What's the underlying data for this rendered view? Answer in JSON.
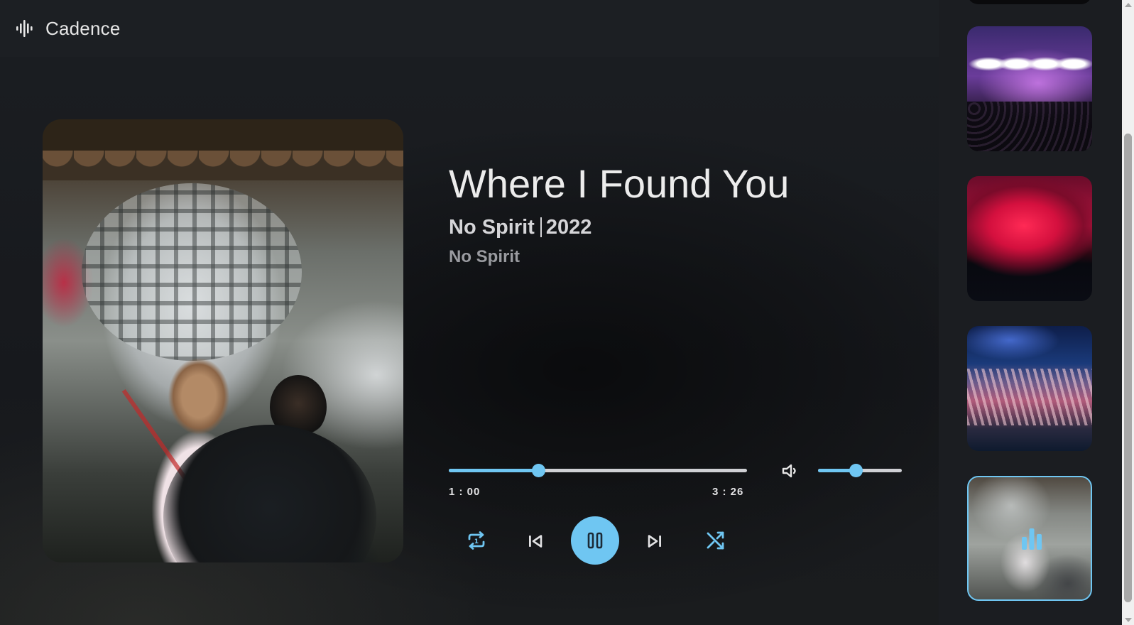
{
  "app": {
    "title": "Cadence",
    "logo_icon": "waveform-icon"
  },
  "now_playing": {
    "title": "Where I Found You",
    "artist": "No Spirit",
    "year": "2022",
    "album": "No Spirit",
    "artwork": "album-artwork"
  },
  "playback": {
    "current_time": "1 : 00",
    "total_time": "3 : 26",
    "progress_fraction": 0.3,
    "volume_fraction": 0.45,
    "state": "playing"
  },
  "controls": {
    "repeat_icon": "repeat-icon",
    "prev_icon": "skip-previous-icon",
    "play_icon": "pause-icon",
    "next_icon": "skip-next-icon",
    "shuffle_icon": "shuffle-icon",
    "volume_icon": "volume-icon"
  },
  "queue": [
    {
      "name": "queue-item-1",
      "active": false
    },
    {
      "name": "queue-item-2",
      "active": false
    },
    {
      "name": "queue-item-3",
      "active": false
    },
    {
      "name": "queue-item-4",
      "active": false
    },
    {
      "name": "queue-item-5",
      "active": true,
      "indicator_icon": "equalizer-icon"
    }
  ],
  "colors": {
    "accent": "#6fc6f2",
    "background": "#16181c",
    "sidebar": "#1b1d21"
  }
}
